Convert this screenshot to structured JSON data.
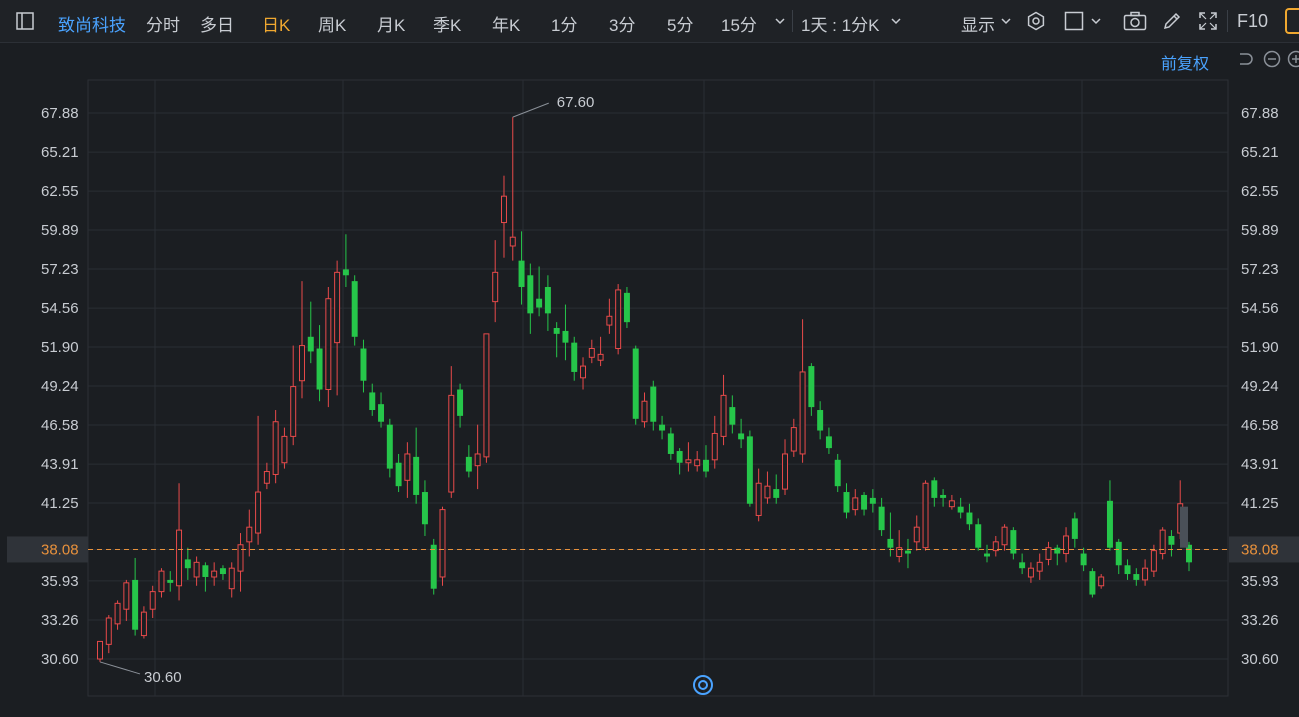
{
  "toolbar": {
    "stock_name": "致尚科技",
    "tabs": [
      {
        "label": "分时",
        "active": false
      },
      {
        "label": "多日",
        "active": false
      },
      {
        "label": "日K",
        "active": true
      },
      {
        "label": "周K",
        "active": false
      },
      {
        "label": "月K",
        "active": false
      },
      {
        "label": "季K",
        "active": false
      },
      {
        "label": "年K",
        "active": false
      },
      {
        "label": "1分",
        "active": false
      },
      {
        "label": "3分",
        "active": false
      },
      {
        "label": "5分",
        "active": false
      },
      {
        "label": "15分",
        "active": false
      }
    ],
    "period_select": "1天 : 1分K",
    "display_label": "显示",
    "f10_label": "F10"
  },
  "sub_toolbar": {
    "adjust_label": "前复权"
  },
  "colors": {
    "up": "#e84a4a",
    "down": "#26c64a",
    "accent": "#4aa3ff",
    "active_tab": "#f0a830",
    "price_line": "#e8913c",
    "background": "#1b1e22"
  },
  "icons": [
    "sidebar-toggle-icon",
    "gear-icon",
    "square-icon",
    "camera-icon",
    "pencil-icon",
    "fullscreen-icon",
    "undo-icon",
    "zoom-out-icon",
    "zoom-in-icon",
    "target-icon"
  ],
  "chart_data": {
    "type": "candlestick",
    "y_ticks": [
      "67.88",
      "65.21",
      "62.55",
      "59.89",
      "57.23",
      "54.56",
      "51.90",
      "49.24",
      "46.58",
      "43.91",
      "41.25",
      "38.08",
      "35.93",
      "33.26",
      "30.60"
    ],
    "ylim": [
      30.6,
      67.88
    ],
    "current_price": "38.08",
    "high_label": "67.60",
    "low_label": "30.60",
    "candles": [
      [
        30.6,
        31.8,
        31.2,
        30.4
      ],
      [
        31.6,
        33.4,
        33.6,
        31.0
      ],
      [
        33.0,
        34.4,
        34.6,
        32.6
      ],
      [
        34.0,
        35.8,
        36.0,
        33.2
      ],
      [
        36.0,
        32.6,
        37.5,
        32.2
      ],
      [
        32.2,
        33.8,
        34.2,
        32.0
      ],
      [
        34.0,
        35.2,
        35.6,
        33.4
      ],
      [
        35.2,
        36.6,
        36.8,
        34.8
      ],
      [
        36.0,
        35.8,
        36.6,
        35.2
      ],
      [
        35.6,
        39.4,
        42.6,
        34.6
      ],
      [
        37.4,
        36.8,
        38.2,
        36.0
      ],
      [
        36.2,
        37.2,
        37.6,
        35.6
      ],
      [
        37.0,
        36.2,
        37.2,
        35.2
      ],
      [
        36.2,
        36.6,
        37.2,
        35.6
      ],
      [
        36.8,
        36.4,
        37.0,
        36.0
      ],
      [
        35.4,
        36.8,
        37.2,
        34.8
      ],
      [
        36.6,
        38.4,
        39.2,
        35.2
      ],
      [
        38.6,
        39.6,
        40.8,
        37.6
      ],
      [
        39.2,
        42.0,
        47.2,
        38.4
      ],
      [
        42.6,
        43.4,
        44.0,
        42.2
      ],
      [
        43.2,
        46.8,
        47.6,
        42.6
      ],
      [
        44.0,
        45.8,
        46.4,
        43.6
      ],
      [
        45.8,
        49.2,
        52.0,
        45.2
      ],
      [
        49.6,
        52.0,
        56.4,
        48.4
      ],
      [
        52.6,
        51.6,
        55.0,
        50.8
      ],
      [
        51.8,
        49.0,
        53.4,
        48.2
      ],
      [
        49.0,
        55.2,
        56.0,
        47.8
      ],
      [
        52.2,
        57.0,
        57.8,
        48.6
      ],
      [
        57.2,
        56.8,
        59.6,
        56.0
      ],
      [
        56.4,
        52.6,
        56.8,
        52.0
      ],
      [
        51.8,
        49.6,
        52.4,
        48.8
      ],
      [
        48.8,
        47.6,
        49.4,
        47.2
      ],
      [
        48.0,
        46.8,
        48.8,
        46.4
      ],
      [
        46.6,
        43.6,
        47.0,
        43.0
      ],
      [
        44.0,
        42.4,
        44.6,
        42.0
      ],
      [
        42.8,
        44.6,
        45.4,
        41.6
      ],
      [
        44.4,
        41.8,
        46.4,
        41.2
      ],
      [
        42.0,
        39.8,
        42.8,
        39.0
      ],
      [
        38.4,
        35.4,
        38.8,
        35.0
      ],
      [
        36.2,
        40.8,
        41.0,
        35.6
      ],
      [
        42.0,
        48.6,
        50.6,
        41.6
      ],
      [
        49.0,
        47.2,
        49.4,
        46.4
      ],
      [
        44.4,
        43.4,
        45.2,
        43.0
      ],
      [
        43.8,
        44.6,
        46.6,
        42.2
      ],
      [
        44.4,
        52.8,
        52.8,
        44.0
      ],
      [
        55.0,
        57.0,
        59.2,
        53.6
      ],
      [
        60.4,
        62.2,
        63.6,
        58.0
      ],
      [
        58.8,
        59.4,
        67.6,
        57.8
      ],
      [
        57.8,
        56.0,
        59.8,
        54.8
      ],
      [
        56.8,
        54.2,
        57.6,
        52.8
      ],
      [
        55.2,
        54.6,
        57.4,
        54.0
      ],
      [
        56.0,
        54.2,
        56.8,
        53.0
      ],
      [
        53.2,
        52.8,
        53.6,
        51.2
      ],
      [
        53.0,
        52.2,
        54.8,
        51.0
      ],
      [
        52.2,
        50.2,
        52.6,
        49.6
      ],
      [
        49.8,
        50.6,
        51.2,
        49.0
      ],
      [
        51.2,
        51.8,
        52.4,
        50.8
      ],
      [
        51.0,
        51.4,
        52.6,
        50.6
      ],
      [
        53.4,
        54.0,
        55.2,
        52.8
      ],
      [
        51.8,
        55.8,
        56.2,
        51.4
      ],
      [
        55.6,
        53.6,
        56.0,
        53.2
      ],
      [
        51.8,
        47.0,
        52.0,
        46.6
      ],
      [
        46.8,
        48.2,
        48.8,
        46.4
      ],
      [
        49.2,
        46.8,
        49.6,
        46.2
      ],
      [
        46.6,
        46.2,
        47.2,
        45.6
      ],
      [
        46.0,
        44.6,
        46.4,
        44.2
      ],
      [
        44.8,
        44.0,
        45.0,
        43.2
      ],
      [
        44.0,
        44.2,
        45.4,
        43.4
      ],
      [
        43.8,
        44.2,
        44.8,
        43.4
      ],
      [
        44.2,
        43.4,
        45.2,
        43.0
      ],
      [
        44.2,
        46.0,
        47.2,
        43.6
      ],
      [
        45.8,
        48.6,
        50.0,
        45.2
      ],
      [
        47.8,
        46.6,
        48.6,
        46.0
      ],
      [
        46.0,
        45.6,
        47.0,
        45.0
      ],
      [
        45.8,
        41.2,
        46.2,
        41.0
      ],
      [
        40.4,
        42.6,
        43.6,
        40.0
      ],
      [
        41.6,
        42.4,
        43.4,
        41.2
      ],
      [
        42.2,
        41.6,
        43.2,
        41.2
      ],
      [
        42.2,
        44.6,
        45.6,
        41.8
      ],
      [
        44.8,
        46.4,
        47.0,
        44.4
      ],
      [
        44.6,
        50.2,
        53.8,
        44.0
      ],
      [
        50.6,
        47.8,
        50.8,
        47.2
      ],
      [
        47.6,
        46.2,
        48.2,
        45.6
      ],
      [
        45.8,
        45.0,
        46.4,
        44.6
      ],
      [
        44.2,
        42.4,
        44.6,
        42.0
      ],
      [
        42.0,
        40.6,
        42.6,
        40.2
      ],
      [
        40.8,
        41.6,
        42.2,
        40.4
      ],
      [
        41.8,
        40.8,
        42.0,
        40.4
      ],
      [
        41.6,
        41.2,
        42.2,
        40.6
      ],
      [
        41.0,
        39.4,
        41.6,
        39.0
      ],
      [
        38.8,
        38.2,
        40.6,
        37.6
      ],
      [
        37.6,
        38.2,
        39.4,
        37.2
      ],
      [
        38.0,
        37.8,
        38.8,
        36.8
      ],
      [
        38.6,
        39.6,
        40.4,
        38.0
      ],
      [
        38.2,
        42.6,
        42.8,
        38.0
      ],
      [
        42.8,
        41.6,
        43.0,
        41.0
      ],
      [
        41.8,
        41.6,
        42.2,
        41.0
      ],
      [
        41.0,
        41.4,
        41.8,
        40.8
      ],
      [
        41.0,
        40.6,
        41.6,
        40.2
      ],
      [
        40.6,
        39.8,
        41.2,
        39.4
      ],
      [
        39.8,
        38.2,
        40.2,
        38.0
      ],
      [
        37.8,
        37.6,
        38.4,
        37.2
      ],
      [
        38.0,
        38.6,
        39.0,
        37.6
      ],
      [
        38.4,
        39.6,
        39.8,
        38.0
      ],
      [
        39.4,
        37.8,
        39.6,
        37.4
      ],
      [
        37.2,
        36.8,
        37.8,
        36.4
      ],
      [
        36.2,
        36.8,
        37.2,
        35.8
      ],
      [
        36.6,
        37.2,
        37.8,
        36.0
      ],
      [
        37.4,
        38.2,
        38.6,
        37.0
      ],
      [
        38.2,
        37.8,
        38.4,
        37.0
      ],
      [
        37.8,
        39.0,
        39.6,
        37.2
      ],
      [
        40.2,
        38.8,
        40.6,
        38.2
      ],
      [
        37.8,
        37.0,
        38.2,
        36.6
      ],
      [
        36.6,
        35.0,
        36.8,
        34.8
      ],
      [
        35.6,
        36.2,
        36.4,
        35.4
      ],
      [
        41.4,
        38.2,
        42.8,
        38.0
      ],
      [
        38.6,
        37.0,
        38.8,
        36.4
      ],
      [
        37.0,
        36.4,
        37.4,
        36.0
      ],
      [
        36.4,
        36.0,
        36.8,
        35.6
      ],
      [
        36.0,
        36.8,
        37.4,
        35.6
      ],
      [
        36.6,
        38.0,
        38.4,
        36.2
      ],
      [
        37.8,
        39.4,
        39.6,
        37.4
      ],
      [
        39.0,
        38.4,
        39.4,
        37.6
      ],
      [
        39.2,
        41.2,
        42.8,
        38.8
      ],
      [
        38.4,
        37.2,
        38.6,
        36.6
      ]
    ]
  }
}
